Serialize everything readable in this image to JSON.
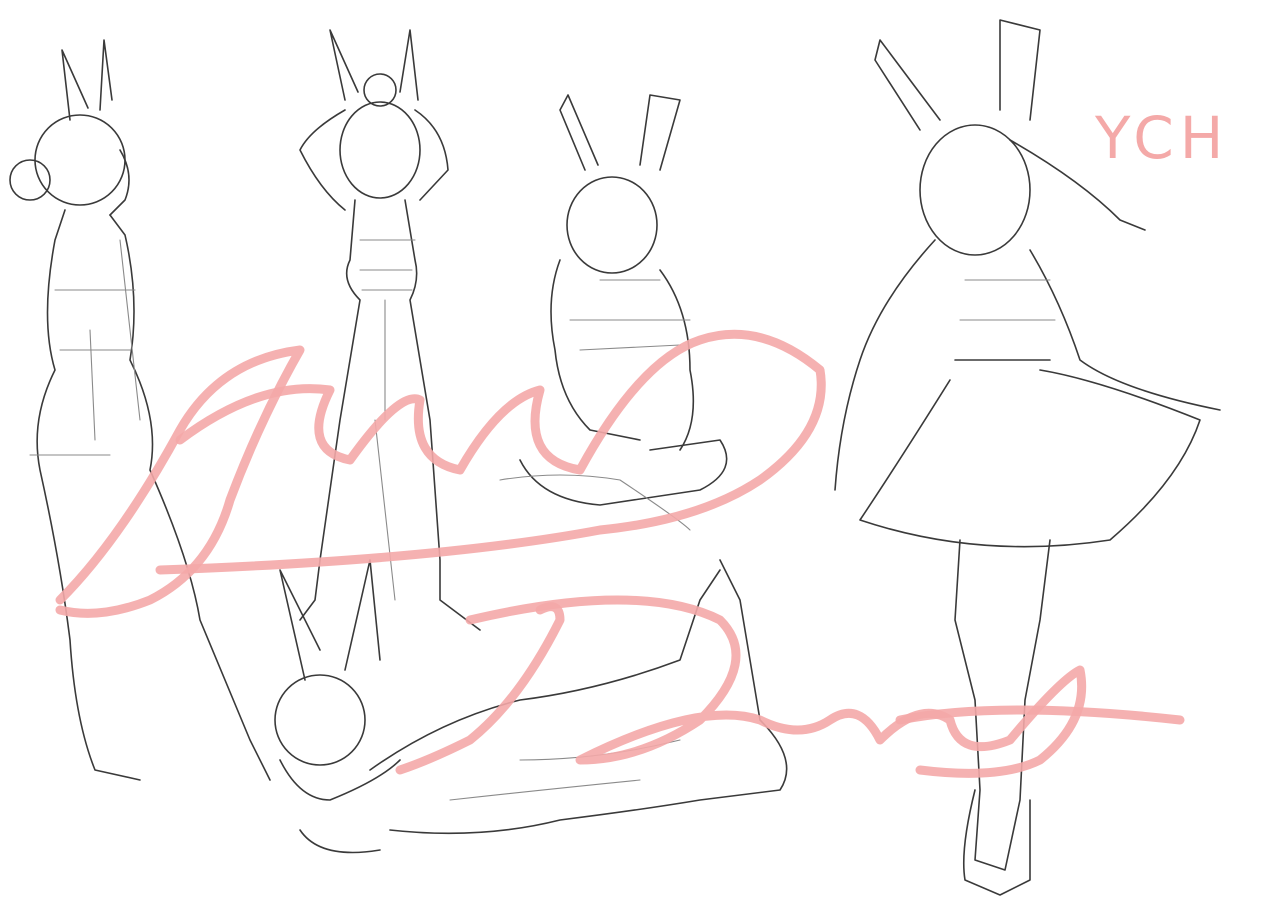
{
  "label_text": "YCH",
  "watermark": {
    "line1": "Jacey",
    "line2": "Draws"
  },
  "colors": {
    "background": "#ffffff",
    "sketch_ink": "#3a3a3a",
    "sketch_light": "#8a8a8a",
    "watermark_pink": "#f4a9a8"
  },
  "figures": [
    "bunny-girl-side-view",
    "bunny-girl-arms-up-jeans",
    "bunny-girl-sitting-tongue-out",
    "bunny-girl-dress-twirl",
    "bunny-girl-lying-down"
  ]
}
